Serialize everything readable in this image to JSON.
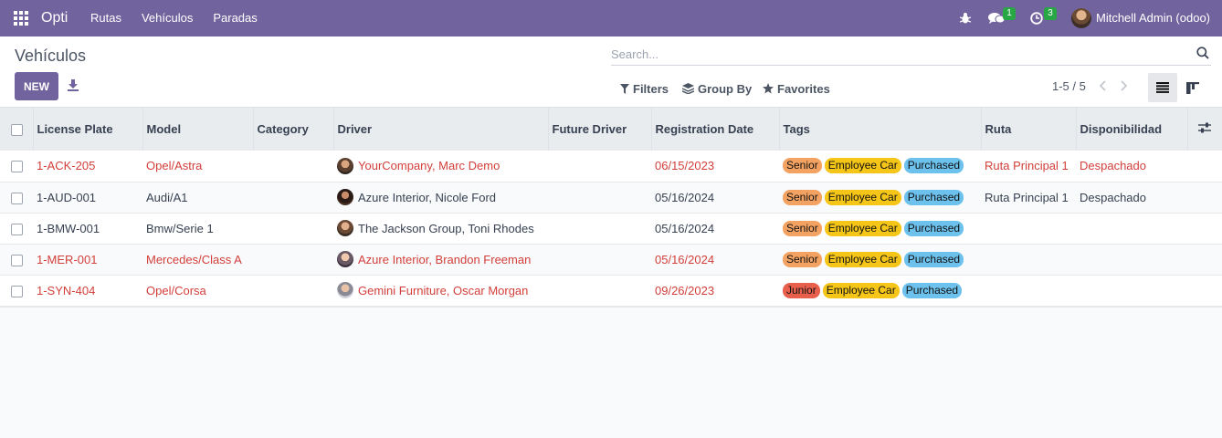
{
  "app": {
    "brand": "Opti",
    "menu": [
      "Rutas",
      "Vehículos",
      "Paradas"
    ],
    "apps_icon": "grid-icon"
  },
  "systray": {
    "bug_icon": "bug-icon",
    "chat_icon": "chat-icon",
    "chat_count": "1",
    "activity_icon": "clock-icon",
    "activity_count": "3",
    "user_name": "Mitchell Admin (odoo)"
  },
  "control_panel": {
    "title": "Vehículos",
    "new_label": "NEW",
    "download_icon": "download-icon",
    "search_placeholder": "Search...",
    "filters_label": "Filters",
    "groupby_label": "Group By",
    "favorites_label": "Favorites",
    "pager": "1-5 / 5",
    "view_list_icon": "list-view-icon",
    "view_kanban_icon": "kanban-view-icon"
  },
  "table": {
    "columns": [
      "License Plate",
      "Model",
      "Category",
      "Driver",
      "Future Driver",
      "Registration Date",
      "Tags",
      "Ruta",
      "Disponibilidad"
    ],
    "rows": [
      {
        "plate": "1-ACK-205",
        "model": "Opel/Astra",
        "category": "",
        "driver": "YourCompany, Marc Demo",
        "future_driver": "",
        "date": "06/15/2023",
        "tags": [
          "Senior",
          "Employee Car",
          "Purchased"
        ],
        "ruta": "Ruta Principal 1",
        "disp": "Despachado",
        "highlight": true
      },
      {
        "plate": "1-AUD-001",
        "model": "Audi/A1",
        "category": "",
        "driver": "Azure Interior, Nicole Ford",
        "future_driver": "",
        "date": "05/16/2024",
        "tags": [
          "Senior",
          "Employee Car",
          "Purchased"
        ],
        "ruta": "Ruta Principal 1",
        "disp": "Despachado",
        "highlight": false
      },
      {
        "plate": "1-BMW-001",
        "model": "Bmw/Serie 1",
        "category": "",
        "driver": "The Jackson Group, Toni Rhodes",
        "future_driver": "",
        "date": "05/16/2024",
        "tags": [
          "Senior",
          "Employee Car",
          "Purchased"
        ],
        "ruta": "",
        "disp": "",
        "highlight": false
      },
      {
        "plate": "1-MER-001",
        "model": "Mercedes/Class A",
        "category": "",
        "driver": "Azure Interior, Brandon Freeman",
        "future_driver": "",
        "date": "05/16/2024",
        "tags": [
          "Senior",
          "Employee Car",
          "Purchased"
        ],
        "ruta": "",
        "disp": "",
        "highlight": true
      },
      {
        "plate": "1-SYN-404",
        "model": "Opel/Corsa",
        "category": "",
        "driver": "Gemini Furniture, Oscar Morgan",
        "future_driver": "",
        "date": "09/26/2023",
        "tags": [
          "Junior",
          "Employee Car",
          "Purchased"
        ],
        "ruta": "",
        "disp": "",
        "highlight": true
      }
    ]
  },
  "colors": {
    "navbar": "#71639e",
    "highlight_text": "#d23f3a",
    "tag_senior": "#f4a261",
    "tag_junior": "#e8604c",
    "tag_employee_car": "#f5c518",
    "tag_purchased": "#6cc1ed"
  }
}
